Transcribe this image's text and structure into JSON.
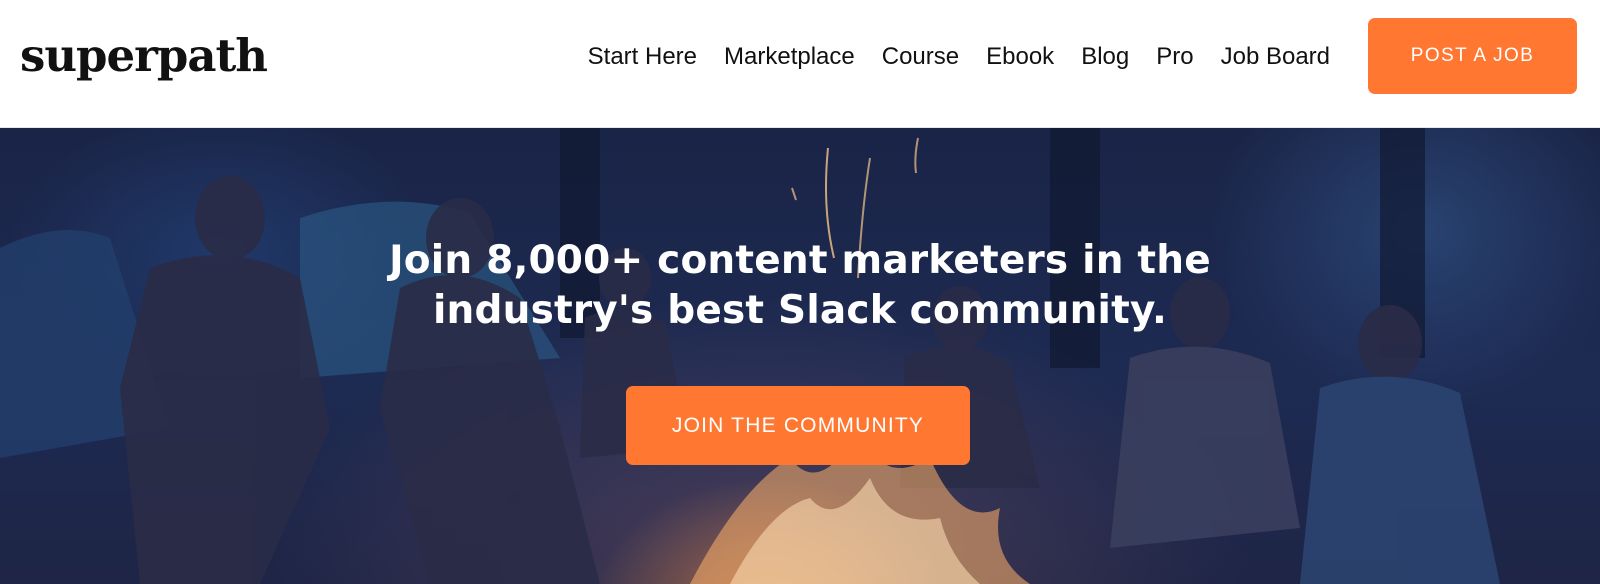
{
  "header": {
    "logo_text": "superpath",
    "nav": [
      {
        "label": "Start Here"
      },
      {
        "label": "Marketplace"
      },
      {
        "label": "Course"
      },
      {
        "label": "Ebook"
      },
      {
        "label": "Blog"
      },
      {
        "label": "Pro"
      },
      {
        "label": "Job Board"
      }
    ],
    "cta_label": "POST A JOB"
  },
  "hero": {
    "headline_line1": "Join 8,000+ content marketers in the",
    "headline_line2": "industry's best Slack community.",
    "cta_label": "JOIN THE COMMUNITY",
    "background_image": "campfire-people-photo"
  },
  "colors": {
    "accent": "#ff7731",
    "hero_overlay": "#1d2a52",
    "text_dark": "#111111"
  }
}
